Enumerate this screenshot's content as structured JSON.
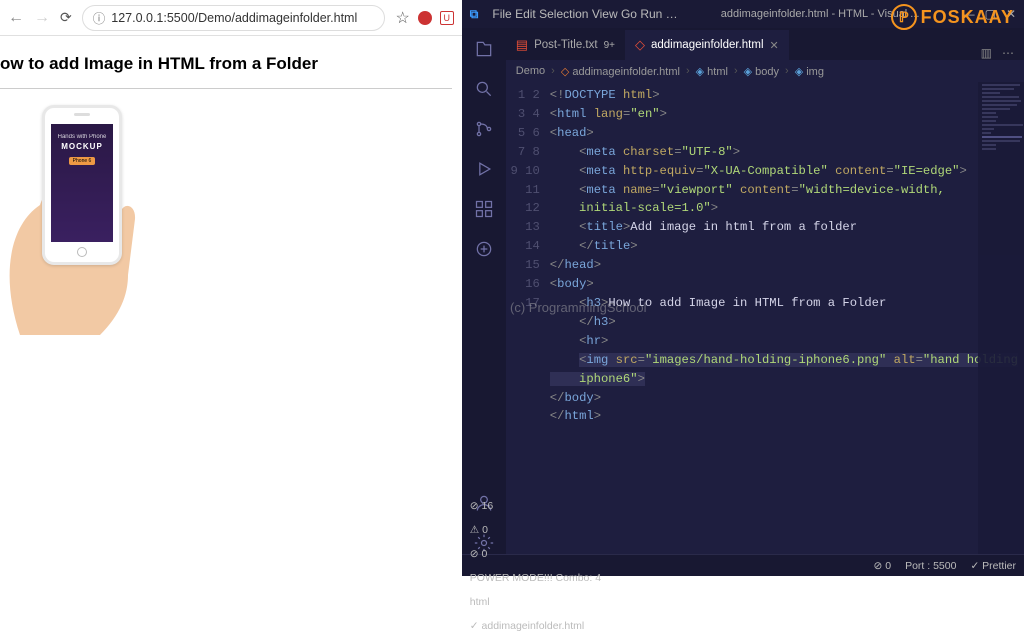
{
  "browser": {
    "url": "127.0.0.1:5500/Demo/addimageinfolder.html",
    "page_heading": "ow to add Image in HTML from a Folder",
    "phone": {
      "line1": "Hands with Phone",
      "line2": "MOCKUP",
      "line3": "Phone 6"
    }
  },
  "watermark": {
    "brand": "FOSKAAY",
    "center": "(c) ProgrammingSchool"
  },
  "vscode": {
    "menu": [
      "File",
      "Edit",
      "Selection",
      "View",
      "Go",
      "Run",
      "…"
    ],
    "title_center": "addimageinfolder.html - HTML - Visual ...",
    "tabs": [
      {
        "icon": "file",
        "label": "Post-Title.txt",
        "badge": "9+",
        "active": false
      },
      {
        "icon": "html",
        "label": "addimageinfolder.html",
        "active": true
      }
    ],
    "breadcrumbs": [
      "Demo",
      "addimageinfolder.html",
      "html",
      "body",
      "img"
    ],
    "code": [
      {
        "n": 1,
        "html": "<span class='t-punc'>&lt;!</span><span class='t-doctype'>DOCTYPE</span> <span class='t-attr'>html</span><span class='t-punc'>&gt;</span>"
      },
      {
        "n": 2,
        "html": "<span class='t-punc'>&lt;</span><span class='t-tag'>html</span> <span class='t-attr'>lang</span><span class='t-punc'>=</span><span class='t-str'>\"en\"</span><span class='t-punc'>&gt;</span>"
      },
      {
        "n": 3,
        "html": "<span class='t-punc'>&lt;</span><span class='t-tag'>head</span><span class='t-punc'>&gt;</span>"
      },
      {
        "n": 4,
        "html": "    <span class='t-punc'>&lt;</span><span class='t-tag'>meta</span> <span class='t-attr'>charset</span><span class='t-punc'>=</span><span class='t-str'>\"UTF-8\"</span><span class='t-punc'>&gt;</span>"
      },
      {
        "n": 5,
        "html": "    <span class='t-punc'>&lt;</span><span class='t-tag'>meta</span> <span class='t-attr'>http-equiv</span><span class='t-punc'>=</span><span class='t-str'>\"X-UA-Compatible\"</span> <span class='t-attr'>content</span><span class='t-punc'>=</span><span class='t-str'>\"IE=edge\"</span><span class='t-punc'>&gt;</span>"
      },
      {
        "n": 6,
        "html": "    <span class='t-punc'>&lt;</span><span class='t-tag'>meta</span> <span class='t-attr'>name</span><span class='t-punc'>=</span><span class='t-str'>\"viewport\"</span> <span class='t-attr'>content</span><span class='t-punc'>=</span><span class='t-str'>\"width=device-width,\n    initial-scale=1.0\"</span><span class='t-punc'>&gt;</span>"
      },
      {
        "n": 7,
        "html": "    <span class='t-punc'>&lt;</span><span class='t-tag'>title</span><span class='t-punc'>&gt;</span><span class='t-text'>Add image in html from a folder</span>"
      },
      {
        "n": 8,
        "html": "    <span class='t-punc'>&lt;/</span><span class='t-tag'>title</span><span class='t-punc'>&gt;</span>"
      },
      {
        "n": 9,
        "html": "<span class='t-punc'>&lt;/</span><span class='t-tag'>head</span><span class='t-punc'>&gt;</span>"
      },
      {
        "n": 10,
        "html": "<span class='t-punc'>&lt;</span><span class='t-tag'>body</span><span class='t-punc'>&gt;</span>"
      },
      {
        "n": 11,
        "html": "    <span class='t-punc'>&lt;</span><span class='t-tag'>h3</span><span class='t-punc'>&gt;</span><span class='t-text'>How to add Image in HTML from a Folder</span>"
      },
      {
        "n": 12,
        "html": "    <span class='t-punc'>&lt;/</span><span class='t-tag'>h3</span><span class='t-punc'>&gt;</span>"
      },
      {
        "n": 13,
        "html": "    <span class='t-punc'>&lt;</span><span class='t-tag'>hr</span><span class='t-punc'>&gt;</span>"
      },
      {
        "n": 14,
        "html": "    <span class='hl'><span class='t-punc'>&lt;</span><span class='t-tag'>img</span> <span class='t-attr'>src</span><span class='t-punc'>=</span><span class='t-str'>\"images/hand-holding-iphone6.png\"</span> <span class='t-attr'>alt</span><span class='t-punc'>=</span><span class='t-str'>\"hand holding\n    iphone6\"</span><span class='t-punc'>&gt;</span></span>"
      },
      {
        "n": 15,
        "html": ""
      },
      {
        "n": 16,
        "html": "<span class='t-punc'>&lt;/</span><span class='t-tag'>body</span><span class='t-punc'>&gt;</span>"
      },
      {
        "n": 17,
        "html": "<span class='t-punc'>&lt;/</span><span class='t-tag'>html</span><span class='t-punc'>&gt;</span>"
      }
    ],
    "status": {
      "left": [
        "⊘ 16",
        "⚠ 0",
        "⊘ 0",
        "POWER MODE!!! Combo: 4",
        "html",
        "✓ addimageinfolder.html"
      ],
      "right": [
        "⊘ 0",
        "Port : 5500",
        "✓ Prettier"
      ]
    }
  }
}
